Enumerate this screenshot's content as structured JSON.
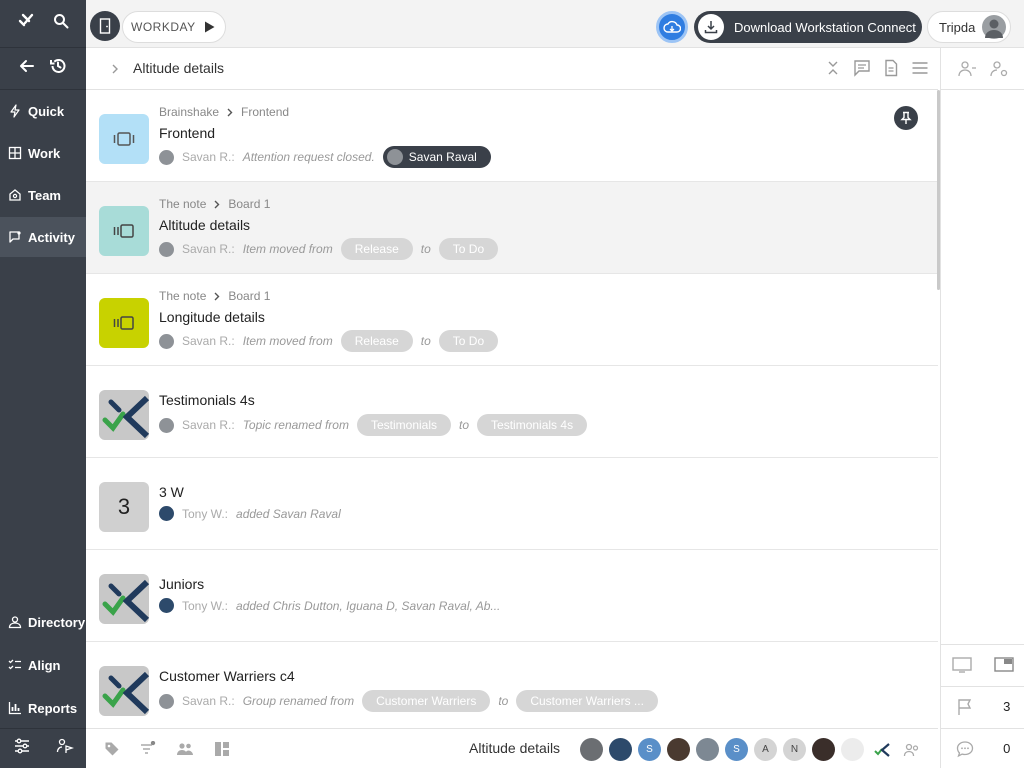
{
  "workday": {
    "label": "WORKDAY"
  },
  "download": {
    "label": "Download Workstation Connect"
  },
  "user": {
    "name": "Tripda"
  },
  "sidebar": {
    "nav": [
      {
        "label": "Quick"
      },
      {
        "label": "Work"
      },
      {
        "label": "Team"
      },
      {
        "label": "Activity"
      }
    ],
    "bottom_nav": [
      {
        "label": "Directory"
      },
      {
        "label": "Align"
      },
      {
        "label": "Reports"
      }
    ]
  },
  "header": {
    "title": "Altitude details"
  },
  "activities": [
    {
      "crumb": [
        "Brainshake",
        "Frontend"
      ],
      "title": "Frontend",
      "author": "Savan R.:",
      "action": "Attention request closed.",
      "person_chip": "Savan Raval",
      "thumb_color": "#b3e0f7",
      "pinned": true
    },
    {
      "crumb": [
        "The note",
        "Board 1"
      ],
      "title": "Altitude details",
      "author": "Savan R.:",
      "action": "Item moved from",
      "from": "Release",
      "to_word": "to",
      "to": "To Do",
      "thumb_color": "#a8dcd8"
    },
    {
      "crumb": [
        "The note",
        "Board 1"
      ],
      "title": "Longitude details",
      "author": "Savan R.:",
      "action": "Item moved from",
      "from": "Release",
      "to_word": "to",
      "to": "To Do",
      "thumb_color": "#c8d200"
    },
    {
      "title": "Testimonials 4s",
      "author": "Savan R.:",
      "action": "Topic renamed from",
      "from": "Testimonials",
      "to_word": "to",
      "to": "Testimonials 4s",
      "thumb": "logo"
    },
    {
      "title": "3 W",
      "author": "Tony W.:",
      "action": "added Savan Raval",
      "thumb": "number",
      "thumb_text": "3"
    },
    {
      "title": "Juniors",
      "author": "Tony W.:",
      "action": "added Chris Dutton, Iguana D, Savan Raval, Ab...",
      "thumb": "logo"
    },
    {
      "title": "Customer Warriers c4",
      "author": "Savan R.:",
      "action": "Group renamed from",
      "from": "Customer Warriers",
      "to_word": "to",
      "to": "Customer Warriers ...",
      "thumb": "logo"
    }
  ],
  "bottom": {
    "title": "Altitude details",
    "members": [
      "",
      "",
      "S",
      "",
      "",
      "S",
      "A",
      "N",
      "",
      "",
      ""
    ]
  },
  "right_panel": {
    "flag_count": "3",
    "comment_count": "0"
  },
  "colors": {
    "sidebar": "#3a4049",
    "accent": "#2f7de1",
    "chip": "#d6d6d6"
  }
}
